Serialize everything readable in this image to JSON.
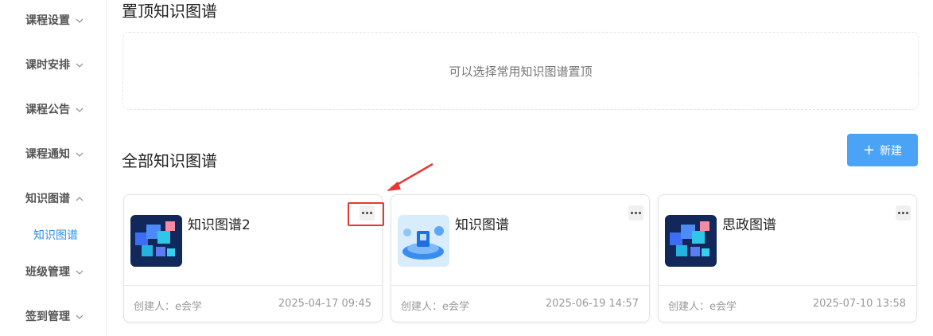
{
  "sidebar": {
    "items": [
      {
        "label": "课程设置",
        "expanded": false
      },
      {
        "label": "课时安排",
        "expanded": false
      },
      {
        "label": "课程公告",
        "expanded": false
      },
      {
        "label": "课程通知",
        "expanded": false
      },
      {
        "label": "知识图谱",
        "expanded": true
      },
      {
        "label": "班级管理",
        "expanded": false
      },
      {
        "label": "签到管理",
        "expanded": false
      }
    ],
    "active_sub_item": "知识图谱"
  },
  "pinned": {
    "title": "置顶知识图谱",
    "empty_text": "可以选择常用知识图谱置顶"
  },
  "all_graphs": {
    "title": "全部知识图谱",
    "new_button_label": "新建",
    "cards": [
      {
        "name": "知识图谱2",
        "creator": "创建人：e会学",
        "date": "2025-04-17 09:45",
        "thumb_style": "cubes"
      },
      {
        "name": "知识图谱",
        "creator": "创建人：e会学",
        "date": "2025-06-19 14:57",
        "thumb_style": "platform"
      },
      {
        "name": "思政图谱",
        "creator": "创建人：e会学",
        "date": "2025-07-10 13:58",
        "thumb_style": "cubes"
      }
    ]
  },
  "colors": {
    "accent": "#2f8fe8",
    "button": "#4ba3f5",
    "highlight": "#e53935"
  }
}
